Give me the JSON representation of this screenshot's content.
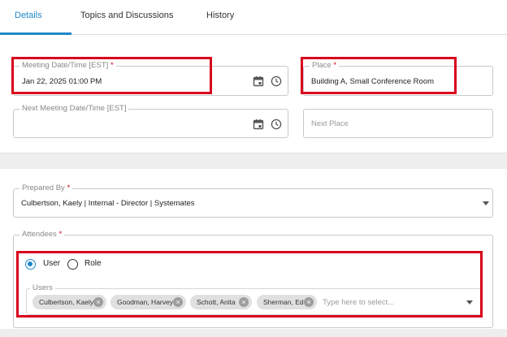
{
  "tabs": [
    {
      "label": "Details"
    },
    {
      "label": "Topics and Discussions"
    },
    {
      "label": "History"
    }
  ],
  "meeting": {
    "date_label": "Meeting Date/Time [EST]",
    "date_value": "Jan 22, 2025 01:00 PM",
    "place_label": "Place",
    "place_value": "Building A, Small Conference Room",
    "next_date_label": "Next Meeting Date/Time [EST]",
    "next_place_placeholder": "Next Place"
  },
  "prepared_by": {
    "label": "Prepared By",
    "value": "Culbertson, Kaely | Internal - Director | Systemates"
  },
  "attendees": {
    "label": "Attendees",
    "options": [
      {
        "label": "User",
        "selected": true
      },
      {
        "label": "Role",
        "selected": false
      }
    ],
    "users_label": "Users",
    "chips": [
      "Culbertson, Kaely",
      "Goodman, Harvey",
      "Schott, Anita",
      "Sherman, Ed"
    ],
    "placeholder": "Type here to select..."
  },
  "colors": {
    "accent": "#1e88c7",
    "required": "#d0021b",
    "highlight": "#d9001b"
  }
}
